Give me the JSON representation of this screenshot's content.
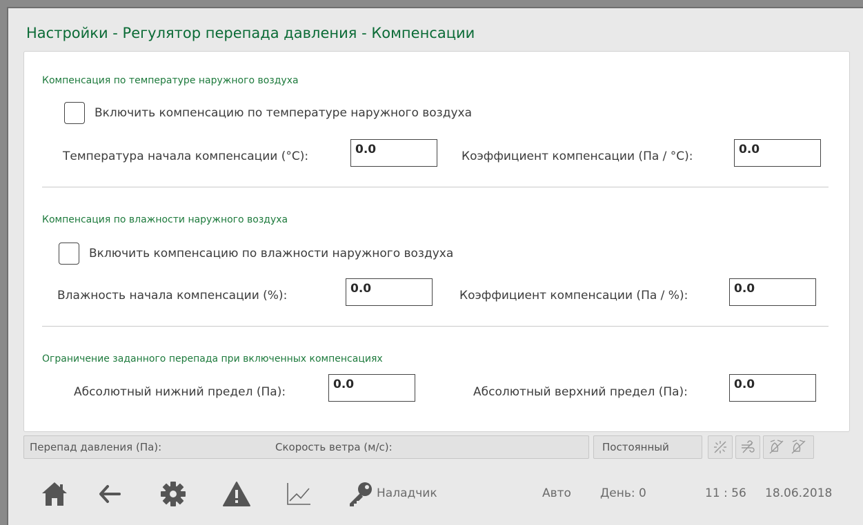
{
  "title": "Настройки - Регулятор перепада давления - Компенсации",
  "temp_section": {
    "title": "Компенсация по температуре наружного воздуха",
    "enable_label": "Включить компенсацию по температуре наружного воздуха",
    "start_label": "Температура начала компенсации (°С):",
    "start_value": "0.0",
    "coef_label": "Коэффициент компенсации (Па / °С):",
    "coef_value": "0.0"
  },
  "humidity_section": {
    "title": "Компенсация по влажности наружного воздуха",
    "enable_label": "Включить компенсацию по влажности наружного воздуха",
    "start_label": "Влажность начала компенсации  (%):",
    "start_value": "0.0",
    "coef_label": "Коэффициент компенсации (Па / %):",
    "coef_value": "0.0"
  },
  "limit_section": {
    "title": "Ограничение заданного перепада при включенных компенсациях",
    "low_label": "Абсолютный нижний предел (Па):",
    "low_value": "0.0",
    "high_label": "Абсолютный верхний предел (Па):",
    "high_value": "0.0"
  },
  "status_bar": {
    "pressure_label": "Перепад давления (Па):",
    "wind_label": "Скорость ветра (м/с):",
    "mode": "Постоянный"
  },
  "bottom_bar": {
    "user": "Наладчик",
    "mode": "Авто",
    "day": "День: 0",
    "time": "11 : 56",
    "date": "18.06.2018"
  },
  "colors": {
    "accent_green": "#0b6b36",
    "icon_gray": "#555555"
  },
  "icons": [
    "home-icon",
    "back-arrow-icon",
    "gear-icon",
    "warning-icon",
    "chart-icon",
    "key-icon"
  ]
}
